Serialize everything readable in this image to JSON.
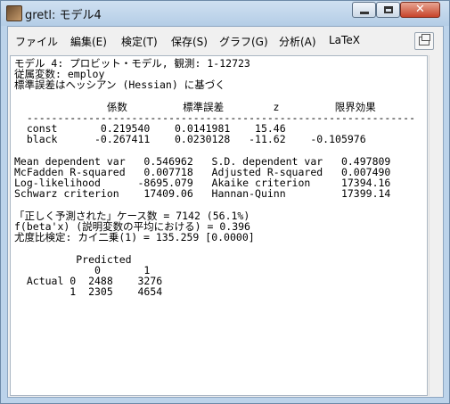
{
  "window": {
    "title": "gretl: モデル4"
  },
  "title_buttons": {
    "minimize": "–",
    "maximize": "□",
    "close": "✕"
  },
  "menu": {
    "items": [
      "ファイル",
      "編集(E)",
      "検定(T)",
      "保存(S)",
      "グラフ(G)",
      "分析(A)",
      "LaTeX"
    ]
  },
  "toolbar": {
    "icon": "window-icon"
  },
  "output": {
    "text": "モデル 4: プロビット・モデル, 観測: 1-12723\n従属変数: employ\n標準誤差はヘッシアン (Hessian) に基づく\n\n               係数         標準誤差        z         限界効果\n  ---------------------------------------------------------------\n  const       0.219540    0.0141981    15.46\n  black      -0.267411    0.0230128   -11.62    -0.105976\n\nMean dependent var   0.546962   S.D. dependent var   0.497809\nMcFadden R-squared   0.007718   Adjusted R-squared   0.007490\nLog-likelihood      -8695.079   Akaike criterion     17394.16\nSchwarz criterion    17409.06   Hannan-Quinn         17399.14\n\n「正しく予測された」ケース数 = 7142 (56.1%)\nf(beta'x) (説明変数の平均における) = 0.396\n尤度比検定: カイ二乗(1) = 135.259 [0.0000]\n\n          Predicted\n             0       1\n  Actual 0  2488    3276\n         1  2305    4654"
  }
}
